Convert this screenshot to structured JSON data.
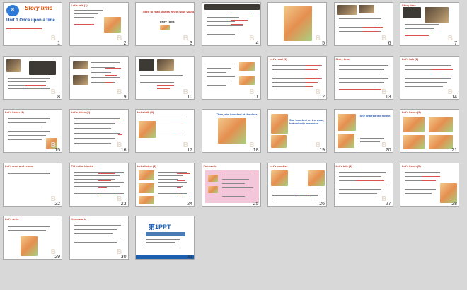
{
  "deck": {
    "module_badge": "8",
    "module_label": "Module",
    "title": "Story time",
    "subtitle": "Unit 1  Once upon a time...",
    "ppt_logo": "第1PPT"
  },
  "slides": [
    {
      "n": "1"
    },
    {
      "n": "2"
    },
    {
      "n": "3"
    },
    {
      "n": "4"
    },
    {
      "n": "5"
    },
    {
      "n": "6"
    },
    {
      "n": "7"
    },
    {
      "n": "8"
    },
    {
      "n": "9"
    },
    {
      "n": "10"
    },
    {
      "n": "11"
    },
    {
      "n": "12"
    },
    {
      "n": "13"
    },
    {
      "n": "14"
    },
    {
      "n": "15"
    },
    {
      "n": "16"
    },
    {
      "n": "17"
    },
    {
      "n": "18"
    },
    {
      "n": "19"
    },
    {
      "n": "20"
    },
    {
      "n": "21"
    },
    {
      "n": "22"
    },
    {
      "n": "23"
    },
    {
      "n": "24"
    },
    {
      "n": "25"
    },
    {
      "n": "26"
    },
    {
      "n": "27"
    },
    {
      "n": "28"
    },
    {
      "n": "29"
    },
    {
      "n": "30"
    },
    {
      "n": "31"
    }
  ],
  "labels": {
    "s2": "Let's talk (1)",
    "s3": "I liked to read stories when I was young.",
    "s3b": "Fairy Tales",
    "s7": "Story time",
    "s12": "Let's read (1)",
    "s13": "Story time",
    "s14": "Let's talk (2)",
    "s15": "Let's listen (1)",
    "s16": "Let's listen (2)",
    "s17": "Let's talk (3)",
    "s18": "Then, she knocked at the door.",
    "s19": "She knocked on the door, but nobody answered.",
    "s20": "She entered the house.",
    "s21": "Let's listen (3)",
    "s22": "Let's read and repeat",
    "s23": "Fill in the blanks",
    "s24": "Let's listen (4)",
    "s25": "Pair work",
    "s26": "Let's practise",
    "s27": "Let's talk (4)",
    "s28": "Let's listen (5)",
    "s29": "Let's write",
    "s30": "Homework"
  },
  "colors": {
    "accent": "#d94a00",
    "blue": "#1d5fb0",
    "border": "#a9a9a9"
  }
}
